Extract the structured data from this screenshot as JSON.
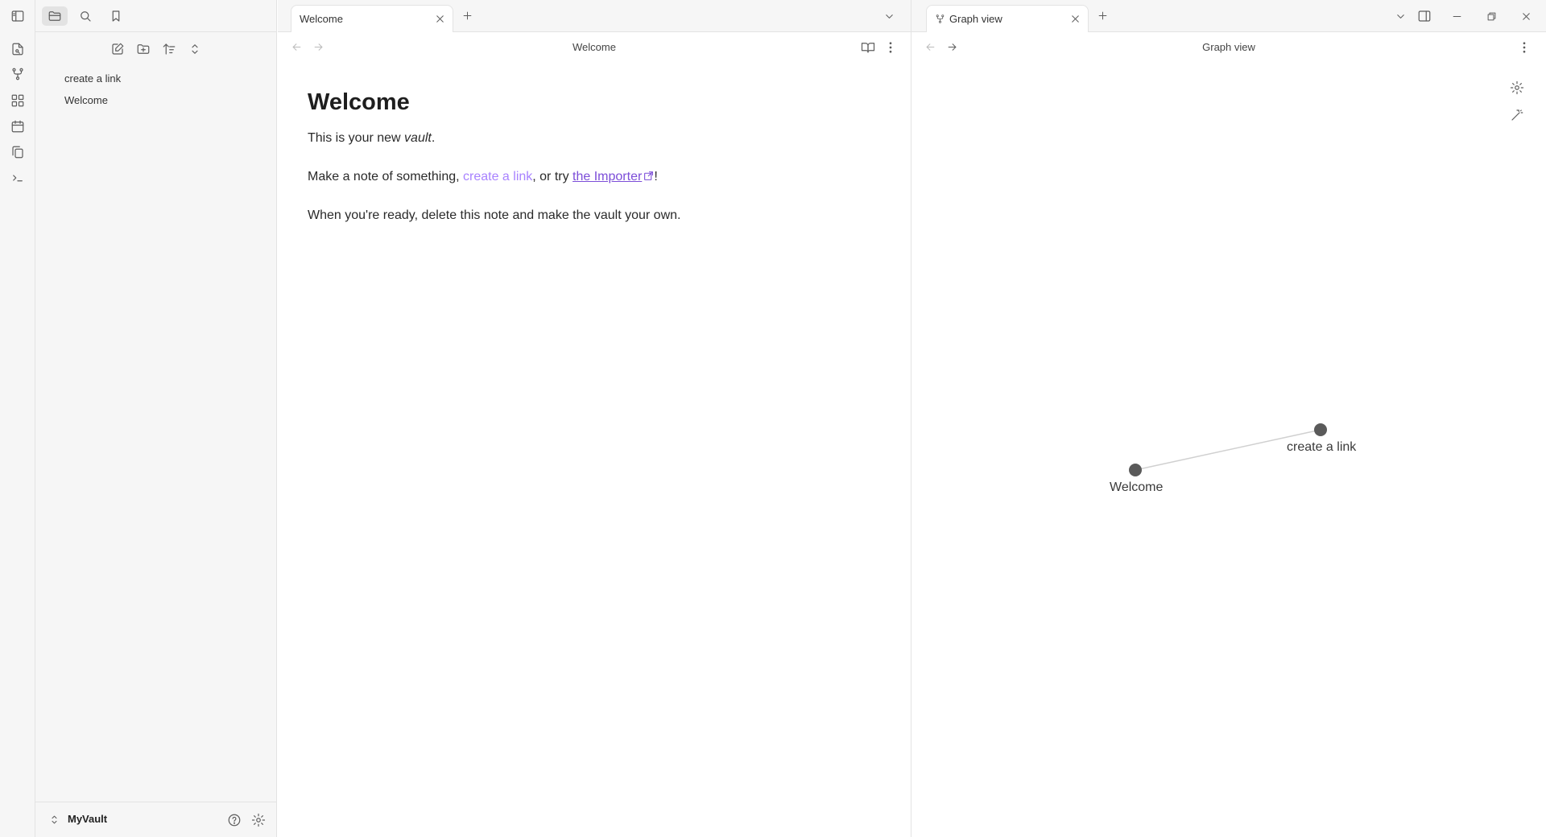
{
  "sidebar": {
    "tree_items": [
      "create a link",
      "Welcome"
    ],
    "vault_name": "MyVault"
  },
  "left_pane": {
    "tab_title": "Welcome",
    "view_title": "Welcome",
    "note": {
      "title": "Welcome",
      "p1_prefix": "This is your new ",
      "p1_em": "vault",
      "p1_suffix": ".",
      "p2_prefix": "Make a note of something, ",
      "p2_link_internal": "create a link",
      "p2_mid": ", or try ",
      "p2_link_external": "the Importer",
      "p2_suffix": "!",
      "p3": "When you're ready, delete this note and make the vault your own."
    }
  },
  "right_pane": {
    "tab_title": "Graph view",
    "view_title": "Graph view",
    "graph": {
      "nodes": [
        {
          "label": "Welcome"
        },
        {
          "label": "create a link"
        }
      ]
    }
  },
  "colors": {
    "accent": "#a882ff",
    "external_link": "#7c4dd8",
    "node": "#5a5a5a",
    "edge": "#d0d0d0"
  }
}
